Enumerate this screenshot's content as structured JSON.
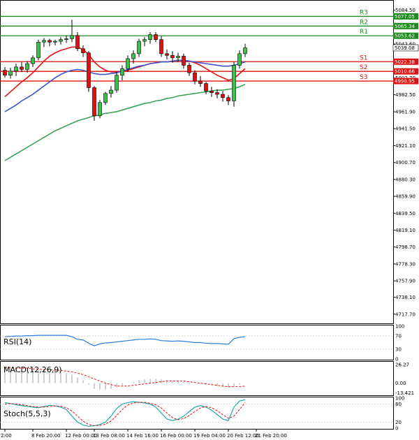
{
  "chart_data": {
    "type": "candlestick",
    "price_axis": {
      "ylim": [
        4707.4,
        5095.1
      ],
      "ticks": [
        "5084.50",
        "5063.75",
        "5043.60",
        "5022.85",
        "5002.70",
        "4982.50",
        "4961.90",
        "4941.50",
        "4921.10",
        "4900.70",
        "4880.30",
        "4859.90",
        "4839.50",
        "4819.10",
        "4798.70",
        "4778.30",
        "4757.90",
        "4738.10",
        "4717.70"
      ]
    },
    "x_axis": {
      "labels": [
        "2:00",
        "8 Feb 20:00",
        "12 Feb 00:00",
        "13 Feb 08:00",
        "14 Feb 16:00",
        "16 Feb 00:00",
        "19 Feb 04:00",
        "20 Feb 12:00",
        "21 Feb 20:00"
      ],
      "label_bars": [
        0,
        5,
        11,
        16,
        22,
        28,
        34,
        40,
        45
      ]
    },
    "levels": [
      {
        "name": "R3",
        "value": 5077.05,
        "color": "#1c8c1c",
        "label": "5077.05"
      },
      {
        "name": "R2",
        "value": 5065.34,
        "color": "#1c8c1c",
        "label": "5065.34"
      },
      {
        "name": "R1",
        "value": 5053.62,
        "color": "#1c8c1c",
        "label": "5053.62"
      },
      {
        "name": "S1",
        "value": 5022.38,
        "color": "#e01010",
        "label": "5022.38"
      },
      {
        "name": "S2",
        "value": 5010.66,
        "color": "#e01010",
        "label": "5010.66"
      },
      {
        "name": "S3",
        "value": 4998.95,
        "color": "#e01010",
        "label": "4998.95"
      }
    ],
    "current_price": "5039.08",
    "candles": [
      {
        "o": 5012,
        "h": 5016,
        "l": 5003,
        "c": 5006
      },
      {
        "o": 5006,
        "h": 5015,
        "l": 5002,
        "c": 5011
      },
      {
        "o": 5011,
        "h": 5020,
        "l": 5005,
        "c": 5016
      },
      {
        "o": 5016,
        "h": 5022,
        "l": 5010,
        "c": 5013
      },
      {
        "o": 5013,
        "h": 5023,
        "l": 5009,
        "c": 5020
      },
      {
        "o": 5020,
        "h": 5030,
        "l": 5016,
        "c": 5027
      },
      {
        "o": 5027,
        "h": 5049,
        "l": 5024,
        "c": 5046
      },
      {
        "o": 5046,
        "h": 5051,
        "l": 5040,
        "c": 5048
      },
      {
        "o": 5048,
        "h": 5050,
        "l": 5041,
        "c": 5046
      },
      {
        "o": 5046,
        "h": 5049,
        "l": 5042,
        "c": 5047
      },
      {
        "o": 5047,
        "h": 5052,
        "l": 5043,
        "c": 5049
      },
      {
        "o": 5049,
        "h": 5054,
        "l": 5045,
        "c": 5050
      },
      {
        "o": 5050,
        "h": 5073,
        "l": 5046,
        "c": 5054
      },
      {
        "o": 5054,
        "h": 5058,
        "l": 5035,
        "c": 5038
      },
      {
        "o": 5038,
        "h": 5042,
        "l": 5028,
        "c": 5033
      },
      {
        "o": 5033,
        "h": 5035,
        "l": 4986,
        "c": 4991
      },
      {
        "o": 4991,
        "h": 4993,
        "l": 4951,
        "c": 4957
      },
      {
        "o": 4957,
        "h": 4976,
        "l": 4954,
        "c": 4973
      },
      {
        "o": 4973,
        "h": 4986,
        "l": 4970,
        "c": 4984
      },
      {
        "o": 4984,
        "h": 4993,
        "l": 4979,
        "c": 4988
      },
      {
        "o": 4988,
        "h": 5010,
        "l": 4985,
        "c": 5006
      },
      {
        "o": 5006,
        "h": 5018,
        "l": 5000,
        "c": 5014
      },
      {
        "o": 5014,
        "h": 5030,
        "l": 5010,
        "c": 5026
      },
      {
        "o": 5026,
        "h": 5036,
        "l": 5020,
        "c": 5032
      },
      {
        "o": 5032,
        "h": 5050,
        "l": 5028,
        "c": 5047
      },
      {
        "o": 5047,
        "h": 5052,
        "l": 5041,
        "c": 5049
      },
      {
        "o": 5049,
        "h": 5058,
        "l": 5044,
        "c": 5055
      },
      {
        "o": 5055,
        "h": 5058,
        "l": 5046,
        "c": 5049
      },
      {
        "o": 5049,
        "h": 5053,
        "l": 5028,
        "c": 5032
      },
      {
        "o": 5032,
        "h": 5037,
        "l": 5025,
        "c": 5030
      },
      {
        "o": 5030,
        "h": 5035,
        "l": 5021,
        "c": 5027
      },
      {
        "o": 5027,
        "h": 5033,
        "l": 5022,
        "c": 5029
      },
      {
        "o": 5029,
        "h": 5032,
        "l": 5014,
        "c": 5018
      },
      {
        "o": 5018,
        "h": 5021,
        "l": 5005,
        "c": 5009
      },
      {
        "o": 5009,
        "h": 5012,
        "l": 4995,
        "c": 4999
      },
      {
        "o": 4999,
        "h": 5005,
        "l": 4992,
        "c": 4996
      },
      {
        "o": 4996,
        "h": 4998,
        "l": 4983,
        "c": 4987
      },
      {
        "o": 4987,
        "h": 4992,
        "l": 4980,
        "c": 4985
      },
      {
        "o": 4985,
        "h": 4989,
        "l": 4978,
        "c": 4983
      },
      {
        "o": 4983,
        "h": 4987,
        "l": 4974,
        "c": 4979
      },
      {
        "o": 4979,
        "h": 4982,
        "l": 4970,
        "c": 4975
      },
      {
        "o": 4975,
        "h": 5022,
        "l": 4968,
        "c": 5018
      },
      {
        "o": 5018,
        "h": 5036,
        "l": 5014,
        "c": 5032
      },
      {
        "o": 5032,
        "h": 5044,
        "l": 5028,
        "c": 5039
      }
    ],
    "moving_averages": [
      {
        "color": "#e01010",
        "values": [
          4980,
          4986,
          4992,
          4998,
          5003,
          5009,
          5016,
          5023,
          5029,
          5033,
          5036,
          5038,
          5040,
          5040,
          5037,
          5031,
          5022,
          5016,
          5012,
          5010,
          5010,
          5011,
          5012,
          5014,
          5016,
          5018,
          5020,
          5021,
          5022,
          5022,
          5023,
          5024,
          5024,
          5023,
          5021,
          5018,
          5014,
          5010,
          5006,
          5003,
          5000,
          5002,
          5008,
          5014
        ]
      },
      {
        "color": "#3b56c9",
        "values": [
          4962,
          4966,
          4970,
          4975,
          4979,
          4983,
          4988,
          4993,
          4998,
          5003,
          5007,
          5010,
          5012,
          5013,
          5012,
          5010,
          5008,
          5007,
          5007,
          5008,
          5009,
          5011,
          5013,
          5015,
          5017,
          5018,
          5020,
          5021,
          5022,
          5022,
          5023,
          5024,
          5024,
          5023,
          5022,
          5021,
          5020,
          5019,
          5018,
          5017,
          5017,
          5018,
          5020,
          5022
        ]
      },
      {
        "color": "#3aa25a",
        "values": [
          4903,
          4907,
          4911,
          4915,
          4919,
          4923,
          4927,
          4931,
          4935,
          4939,
          4942,
          4945,
          4948,
          4951,
          4953,
          4955,
          4957,
          4958,
          4960,
          4961,
          4962,
          4964,
          4966,
          4968,
          4970,
          4972,
          4973,
          4975,
          4976,
          4978,
          4979,
          4981,
          4982,
          4983,
          4984,
          4985,
          4986,
          4987,
          4988,
          4988,
          4989,
          4990,
          4992,
          4995
        ]
      }
    ],
    "rsi": {
      "title": "RSI(14)",
      "ylim": [
        0,
        100
      ],
      "ticks": [
        "100",
        "70",
        "30",
        "0"
      ],
      "values": [
        68,
        69,
        70,
        70,
        71,
        71,
        72,
        72,
        72,
        72,
        72,
        72,
        68,
        60,
        58,
        48,
        40,
        46,
        49,
        50,
        52,
        54,
        56,
        58,
        60,
        60,
        61,
        60,
        56,
        55,
        54,
        55,
        54,
        52,
        50,
        50,
        48,
        47,
        47,
        46,
        45,
        62,
        66,
        68
      ]
    },
    "macd": {
      "title": "MACD(12,26,9)",
      "ylim": [
        -16,
        29
      ],
      "ticks": [
        "26.27",
        "0.00",
        "-13.421"
      ],
      "hist": [
        22,
        21,
        20,
        20,
        19,
        19,
        18,
        18,
        17,
        16,
        15,
        14,
        12,
        8,
        4,
        -2,
        -8,
        -9,
        -9,
        -8,
        -6,
        -3,
        0,
        2,
        4,
        5,
        6,
        6,
        5,
        4,
        3,
        3,
        2,
        1,
        0,
        -1,
        -2,
        -3,
        -4,
        -5,
        -6,
        -4,
        -2,
        0
      ],
      "signal": [
        22,
        22,
        21,
        21,
        21,
        20,
        20,
        19,
        19,
        18,
        18,
        17,
        16,
        14,
        12,
        9,
        6,
        3,
        0,
        -2,
        -4,
        -4,
        -4,
        -3,
        -2,
        -1,
        0,
        1,
        2,
        3,
        3,
        3,
        3,
        2,
        1,
        0,
        -1,
        -2,
        -3,
        -4,
        -5,
        -5,
        -5,
        -4
      ]
    },
    "stoch": {
      "title": "Stoch(5,5,3)",
      "ylim": [
        0,
        100
      ],
      "ticks": [
        "100",
        "80",
        "20",
        "0"
      ],
      "main": [
        85,
        82,
        78,
        75,
        72,
        70,
        68,
        72,
        76,
        74,
        70,
        62,
        40,
        20,
        10,
        6,
        8,
        12,
        20,
        40,
        65,
        80,
        85,
        88,
        86,
        84,
        80,
        70,
        50,
        30,
        25,
        30,
        40,
        55,
        70,
        75,
        70,
        60,
        45,
        30,
        25,
        70,
        90,
        95
      ],
      "signal": [
        80,
        82,
        80,
        78,
        75,
        72,
        70,
        70,
        72,
        74,
        73,
        68,
        57,
        40,
        23,
        12,
        8,
        9,
        13,
        24,
        42,
        62,
        77,
        84,
        86,
        86,
        83,
        78,
        67,
        50,
        35,
        28,
        32,
        42,
        55,
        67,
        72,
        68,
        58,
        45,
        33,
        40,
        62,
        85
      ]
    }
  }
}
